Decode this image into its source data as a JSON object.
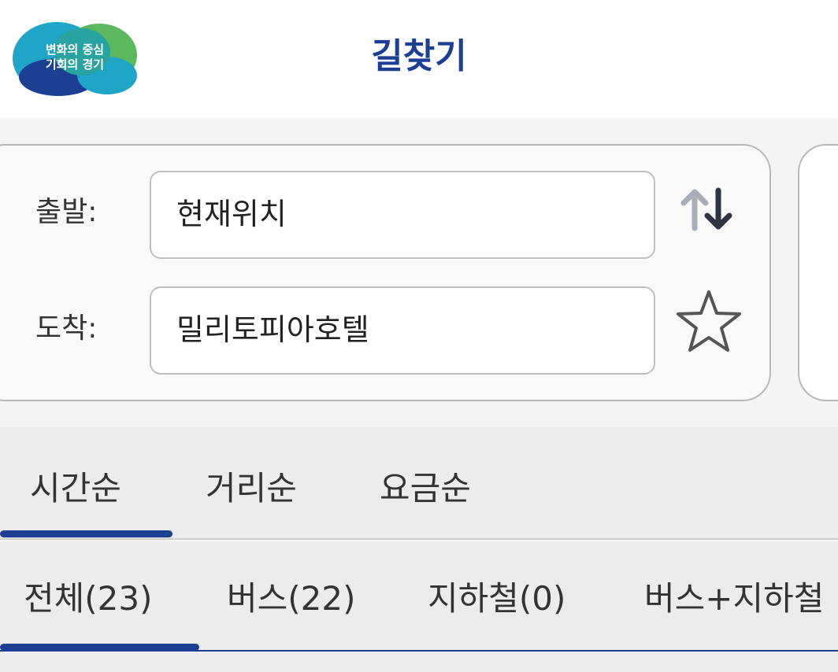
{
  "header": {
    "logo": {
      "line1": "변화의 중심",
      "line2": "기회의 경기",
      "colors": [
        "#1c3f94",
        "#5cb85c",
        "#1fa5c7"
      ]
    },
    "title": "길찾기"
  },
  "route": {
    "origin_label": "출발:",
    "origin_value": "현재위치",
    "destination_label": "도착:",
    "destination_value": "밀리토피아호텔",
    "swap_icon": "swap-vertical-icon",
    "favorite_icon": "star-outline-icon"
  },
  "sort_tabs": [
    {
      "label": "시간순",
      "active": true
    },
    {
      "label": "거리순",
      "active": false
    },
    {
      "label": "요금순",
      "active": false
    }
  ],
  "filter_tabs": [
    {
      "label": "전체(23)",
      "active": true
    },
    {
      "label": "버스(22)",
      "active": false
    },
    {
      "label": "지하철(0)",
      "active": false
    },
    {
      "label": "버스+지하철",
      "active": false
    }
  ],
  "colors": {
    "accent": "#1c3f94",
    "swap_up_arrow": "#a9adb6",
    "swap_down_arrow": "#2f3440"
  }
}
